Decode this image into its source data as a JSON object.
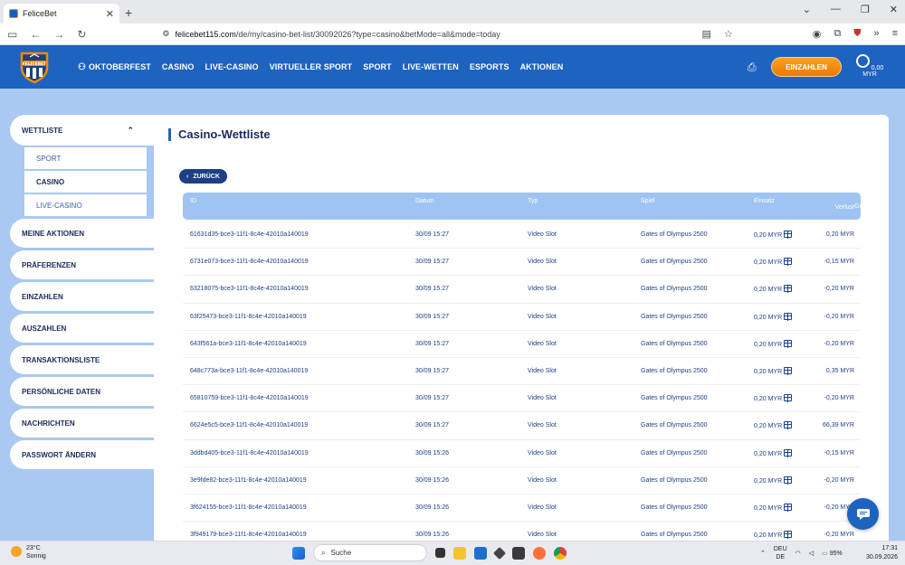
{
  "browser": {
    "tab_title": "FeliceBet",
    "url_host": "felicebet115.com",
    "url_path": "/de/my/casino-bet-list/30092026?type=casino&betMode=all&mode=today"
  },
  "header": {
    "logo_text": "FELICEBET",
    "menu": [
      "OKTOBERFEST",
      "CASINO",
      "LIVE-CASINO",
      "VIRTUELLER SPORT",
      "SPORT",
      "LIVE-WETTEN",
      "ESPORTS",
      "AKTIONEN"
    ],
    "deposit_label": "EINZAHLEN",
    "balance": "0,00 MYR"
  },
  "sidebar": {
    "head": "WETTLISTE",
    "sub": [
      "SPORT",
      "CASINO",
      "LIVE-CASINO"
    ],
    "items": [
      "MEINE AKTIONEN",
      "PRÄFERENZEN",
      "EINZAHLEN",
      "AUSZAHLEN",
      "TRANSAKTIONSLISTE",
      "PERSÖNLICHE DATEN",
      "NACHRICHTEN",
      "PASSWORT ÄNDERN"
    ]
  },
  "content": {
    "title": "Casino-Wettliste",
    "back_label": "ZURÜCK"
  },
  "table": {
    "columns": [
      "ID",
      "Datum",
      "Typ",
      "Spiel",
      "Einsatz",
      "Gewinn-",
      "Verlust"
    ],
    "rows": [
      [
        "61631d35-bce3-11f1-8c4e-42010a140019",
        "30/09 15:27",
        "Video Slot",
        "Gates of Olympus 2500",
        "0,20 MYR",
        "0,20 MYR"
      ],
      [
        "6731e073-bce3-11f1-8c4e-42010a140019",
        "30/09 15:27",
        "Video Slot",
        "Gates of Olympus 2500",
        "0,20 MYR",
        "-0,15 MYR"
      ],
      [
        "63218075-bce3-11f1-8c4e-42010a140019",
        "30/09 15:27",
        "Video Slot",
        "Gates of Olympus 2500",
        "0,20 MYR",
        "-0,20 MYR"
      ],
      [
        "63f25473-bce3-11f1-8c4e-42010a140019",
        "30/09 15:27",
        "Video Slot",
        "Gates of Olympus 2500",
        "0,20 MYR",
        "-0,20 MYR"
      ],
      [
        "643f561a-bce3-11f1-8c4e-42010a140019",
        "30/09 15:27",
        "Video Slot",
        "Gates of Olympus 2500",
        "0,20 MYR",
        "-0,20 MYR"
      ],
      [
        "648c773a-bce3-11f1-8c4e-42010a140019",
        "30/09 15:27",
        "Video Slot",
        "Gates of Olympus 2500",
        "0,20 MYR",
        "0,35 MYR"
      ],
      [
        "65810759-bce3-11f1-8c4e-42010a140019",
        "30/09 15:27",
        "Video Slot",
        "Gates of Olympus 2500",
        "0,20 MYR",
        "-0,20 MYR"
      ],
      [
        "6624e5c5-bce3-11f1-8c4e-42010a140019",
        "30/09 15:27",
        "Video Slot",
        "Gates of Olympus 2500",
        "0,20 MYR",
        "66,39 MYR"
      ],
      [
        "3ddbd405-bce3-11f1-8c4e-42010a140019",
        "30/09 15:26",
        "Video Slot",
        "Gates of Olympus 2500",
        "0,20 MYR",
        "-0,15 MYR"
      ],
      [
        "3e9fde82-bce3-11f1-8c4e-42010a140019",
        "30/09 15:26",
        "Video Slot",
        "Gates of Olympus 2500",
        "0,20 MYR",
        "-0,20 MYR"
      ],
      [
        "3f624155-bce3-11f1-8c4e-42010a140019",
        "30/09 15:26",
        "Video Slot",
        "Gates of Olympus 2500",
        "0,20 MYR",
        "-0,20 MYR"
      ],
      [
        "3f949179-bce3-11f1-8c4e-42010a140019",
        "30/09 15:26",
        "Video Slot",
        "Gates of Olympus 2500",
        "0,20 MYR",
        "-0,20 MYR"
      ]
    ]
  },
  "taskbar": {
    "temp": "23°C",
    "weather": "Sonnig",
    "search_label": "Suche",
    "lang1": "DEU",
    "lang2": "DE",
    "battery": "95%",
    "time": "17:31",
    "date": "30.09.2026"
  },
  "colors": {
    "header": "#1e63bf",
    "page_bg": "#a9c8f2",
    "accent": "#f08a00"
  }
}
